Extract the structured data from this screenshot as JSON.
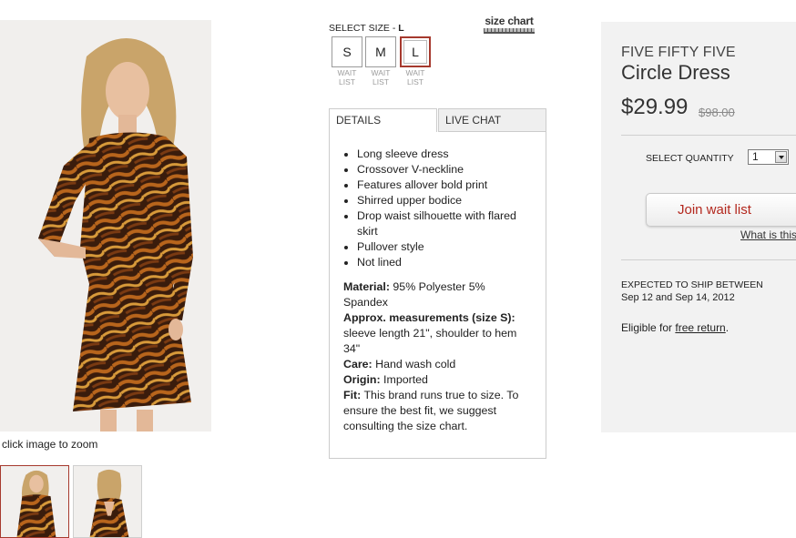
{
  "gallery": {
    "zoom_hint": "click image to zoom",
    "thumbnails": [
      {
        "icon": "model-front-icon",
        "selected": true
      },
      {
        "icon": "model-back-icon",
        "selected": false
      }
    ]
  },
  "size": {
    "label": "SELECT SIZE - ",
    "selected": "L",
    "chart_link": "size chart",
    "options": [
      {
        "label": "S",
        "status_line1": "WAIT",
        "status_line2": "LIST"
      },
      {
        "label": "M",
        "status_line1": "WAIT",
        "status_line2": "LIST"
      },
      {
        "label": "L",
        "status_line1": "WAIT",
        "status_line2": "LIST"
      }
    ]
  },
  "tabs": {
    "details": "DETAILS",
    "live_chat": "LIVE CHAT"
  },
  "details": {
    "bullets": [
      "Long sleeve dress",
      "Crossover V-neckline",
      "Features allover bold print",
      "Shirred upper bodice",
      "Drop waist silhouette with flared skirt",
      "Pullover style",
      "Not lined"
    ],
    "material_label": "Material:",
    "material": " 95% Polyester 5% Spandex",
    "measurements_label": "Approx. measurements (size S):",
    "measurements": " sleeve length 21\", shoulder to hem 34\"",
    "care_label": "Care:",
    "care": " Hand wash cold",
    "origin_label": "Origin:",
    "origin": " Imported",
    "fit_label": "Fit:",
    "fit": " This brand runs true to size. To ensure the best fit, we suggest consulting the size chart."
  },
  "product": {
    "brand": "FIVE FIFTY FIVE",
    "name": "Circle Dress",
    "price": "$29.99",
    "original_price": "$98.00"
  },
  "purchase": {
    "quantity_label": "SELECT QUANTITY",
    "quantity_value": "1",
    "wait_button": "Join wait list",
    "what_link": "What is this?",
    "ship_label": "EXPECTED TO SHIP BETWEEN",
    "ship_dates": "Sep 12 and Sep 14, 2012",
    "return_prefix": "Eligible for ",
    "return_link": "free return",
    "return_suffix": "."
  },
  "colors": {
    "accent_red": "#b3281e",
    "selected_border": "#a6392e",
    "panel_bg": "#f2f2f2"
  }
}
